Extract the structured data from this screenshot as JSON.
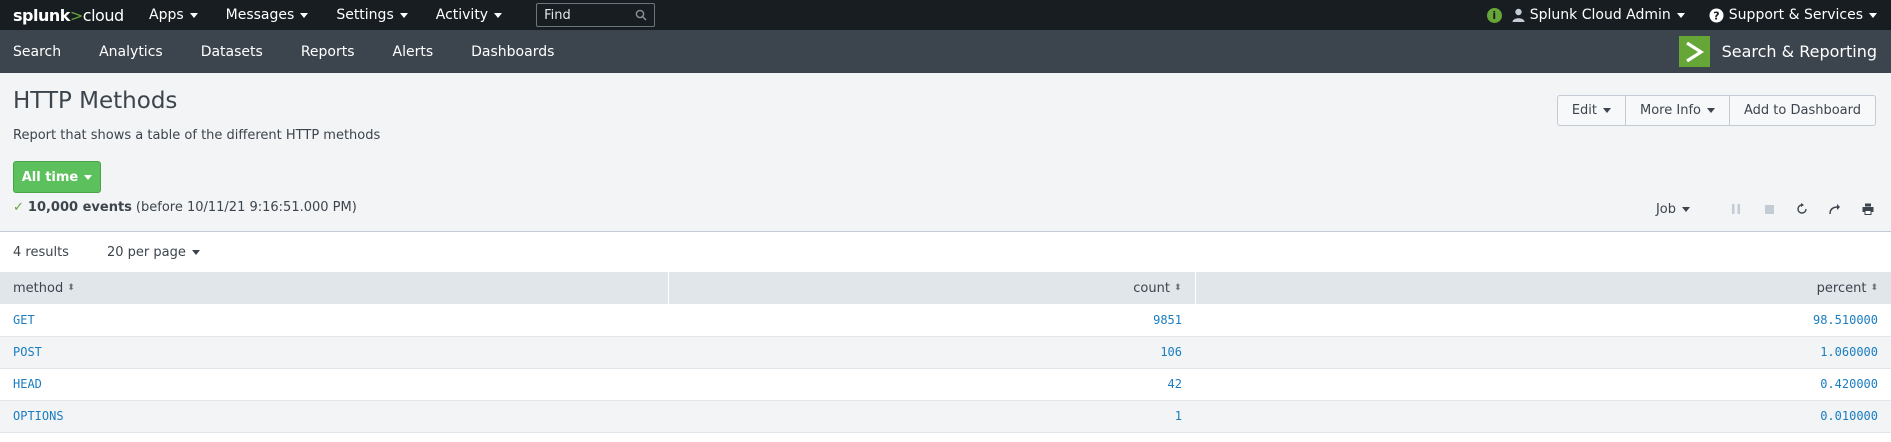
{
  "topbar": {
    "logo_main": "splunk",
    "logo_sep": ">",
    "logo_sub": "cloud",
    "menus": [
      "Apps",
      "Messages",
      "Settings",
      "Activity"
    ],
    "find_placeholder": "Find",
    "user": "Splunk Cloud Admin",
    "support": "Support & Services"
  },
  "appbar": {
    "items": [
      "Search",
      "Analytics",
      "Datasets",
      "Reports",
      "Alerts",
      "Dashboards"
    ],
    "app_name": "Search & Reporting",
    "app_color": "#65a637"
  },
  "header": {
    "title": "HTTP Methods",
    "description": "Report that shows a table of the different HTTP methods",
    "time_button": "All time",
    "status_check": "✓",
    "events": "10,000 events",
    "before": "(before 10/11/21 9:16:51.000 PM)",
    "buttons": [
      "Edit",
      "More Info",
      "Add to Dashboard"
    ],
    "job": "Job"
  },
  "results": {
    "count": "4 results",
    "per_page": "20 per page"
  },
  "table": {
    "columns": [
      "method",
      "count",
      "percent"
    ],
    "rows": [
      [
        "GET",
        "9851",
        "98.510000"
      ],
      [
        "POST",
        "106",
        "1.060000"
      ],
      [
        "HEAD",
        "42",
        "0.420000"
      ],
      [
        "OPTIONS",
        "1",
        "0.010000"
      ]
    ]
  }
}
